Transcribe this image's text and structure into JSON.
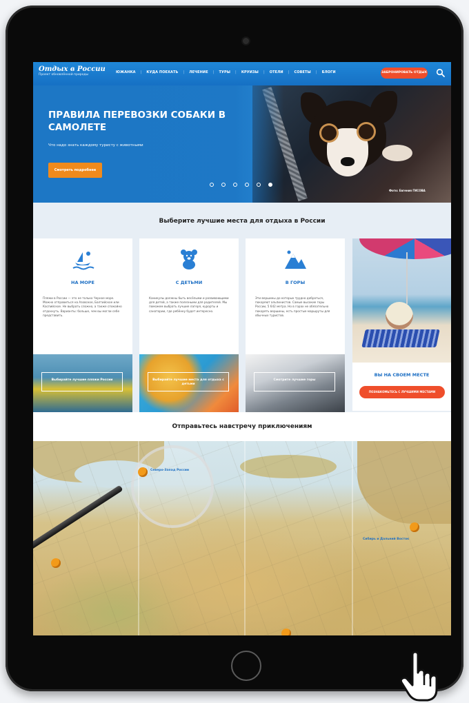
{
  "site": {
    "logo_title": "Отдых в России",
    "logo_subtitle": "Проект обновлённой природы",
    "nav": [
      "ЮЖАНКА",
      "КУДА ПОЕХАТЬ",
      "ЛЕЧЕНИЕ",
      "ТУРЫ",
      "КРУИЗЫ",
      "ОТЕЛИ",
      "СОВЕТЫ",
      "БЛОГИ"
    ],
    "header_button": "ЗАБРОНИРОВАТЬ ОТДЫХ",
    "search_icon": "search-icon"
  },
  "hero": {
    "title": "ПРАВИЛА ПЕРЕВОЗКИ СОБАКИ В САМОЛЕТЕ",
    "subtitle": "Что надо знать каждому туристу с животными",
    "button": "Смотреть подробнее",
    "credit": "Фото: Евгения ГИСОВА",
    "slides_total": 6,
    "active_slide": 6
  },
  "section1": {
    "title": "Выберите лучшие места для отдыха в России",
    "cards": [
      {
        "icon": "sea-icon",
        "title": "НА МОРЕ",
        "text": "Пляжи в России — это не только Черное море. Можно отправиться на Азовское, Балтийское или Каспийское. Не выбрать сложно, а также спокойно отдохнуть. Варианты: больше, чем вы могли себе представить.",
        "image_button": "Выбирайте лучшие пляжи России"
      },
      {
        "icon": "teddy-bear-icon",
        "title": "С ДЕТЬМИ",
        "text": "Каникулы должны быть весёлыми и развивающими для детей, а также полезными для родителей. Мы поможем выбрать лучшие лагеря, курорты и санатории, где ребёнку будет интересно.",
        "image_button": "Выбирайте лучшие места для отдыха с детьми"
      },
      {
        "icon": "mountain-icon",
        "title": "В ГОРЫ",
        "text": "Эти вершины до которых трудно добраться, покоряют альпинистов. Самые высокие горы России, 5 642 метра. Но в горах не обязательно покорять вершины, есть простые маршруты для обычных туристов.",
        "image_button": "Смотрите лучшие горы"
      }
    ],
    "promo": {
      "title": "ВЫ НА СВОЕМ МЕСТЕ",
      "button": "ПОЗНАКОМЬТЕСЬ С ЛУЧШИМИ МЕСТАМИ"
    }
  },
  "section2": {
    "title": "Отправьтесь навстречу приключениям",
    "map_pins": [
      "Северо-Запад России",
      "Сибирь и Дальний Восток"
    ]
  }
}
